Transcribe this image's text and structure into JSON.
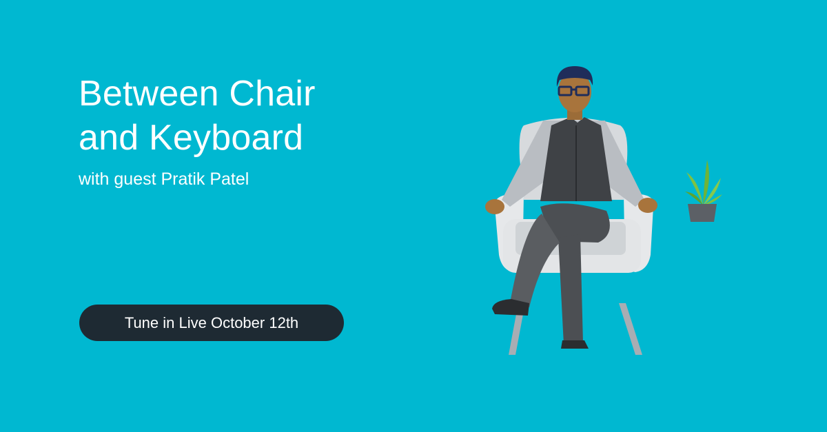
{
  "banner": {
    "title_lines": [
      "Between Chair",
      "and Keyboard"
    ],
    "subtitle": "with guest Pratik Patel",
    "cta_label": "Tune in Live October 12th"
  },
  "colors": {
    "background": "#00b8d1",
    "cta_background": "#1e2a33",
    "text": "#ffffff"
  },
  "illustration": {
    "subject": "person-seated-in-armchair-icon",
    "decor": "potted-plant-icon"
  }
}
